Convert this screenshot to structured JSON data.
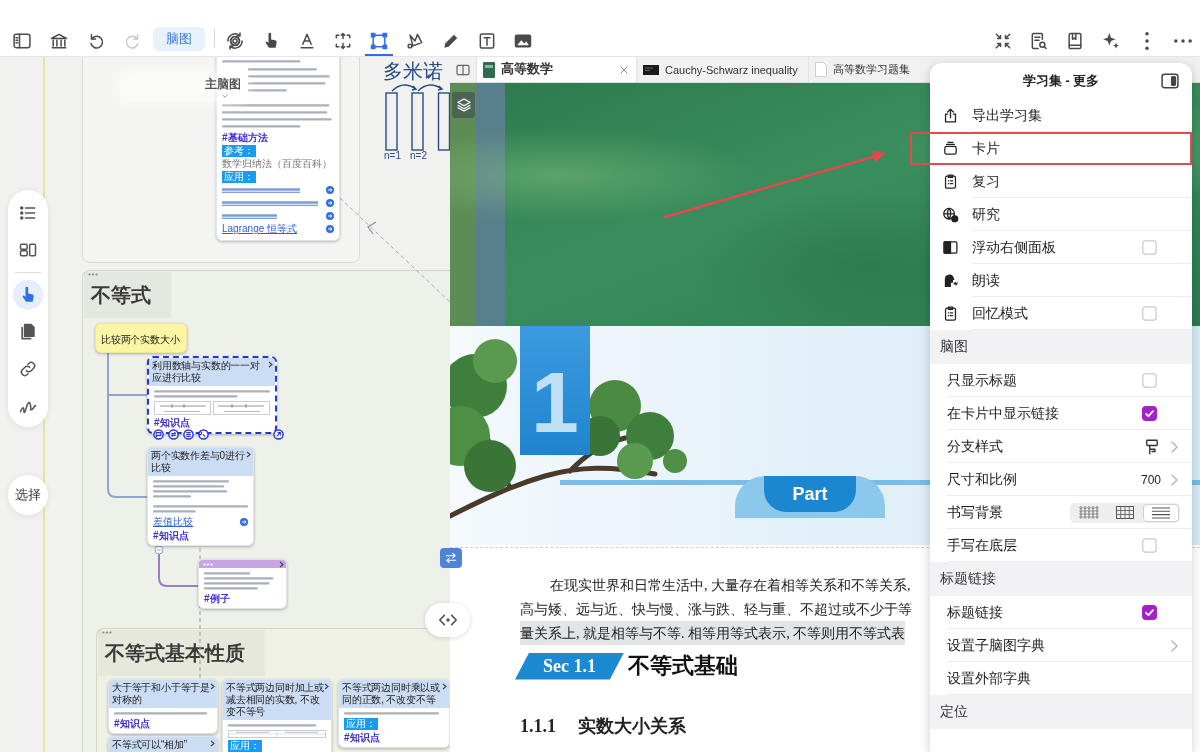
{
  "toolbar": {
    "history": [
      {
        "disabled": false
      },
      {
        "disabled": true
      }
    ],
    "mode_button": "脑图",
    "tools": [
      {
        "selected": false
      },
      {
        "selected": false
      },
      {
        "selected": false
      },
      {
        "selected": false
      },
      {
        "selected": true
      },
      {
        "selected": false
      },
      {
        "selected": false
      },
      {
        "selected": false
      },
      {
        "selected": false
      }
    ]
  },
  "canvas_tools": [
    {
      "selected": false
    },
    {
      "selected": false
    },
    {
      "selected": true
    },
    {
      "selected": false
    },
    {
      "selected": false
    },
    {
      "selected": false
    }
  ],
  "select_button": "选择",
  "mindmap": {
    "title": "主脑图",
    "sketch": {
      "caption": "多米诺",
      "labels": [
        "n=1",
        "n=2"
      ]
    },
    "top_card": {
      "tag": "#基础方法",
      "reference_label": "参考：",
      "reference": "数学归纳法（百度百科）",
      "applications_label": "应用：",
      "link": "Lagrange 恒等式"
    },
    "groups": [
      {
        "title": "不等式",
        "cards": [
          {
            "kind": "topic",
            "title": "比较两个实数大小",
            "selected": false
          },
          {
            "kind": "note",
            "title": "利用数轴与实数的一一对应进行比较",
            "selected": true,
            "figure": {
              "kind": "number-lines"
            },
            "tag": "#知识点"
          },
          {
            "kind": "note",
            "title": "两个实数作差与0进行比较",
            "selected": false,
            "link": "差值比较",
            "tag": "#知识点"
          },
          {
            "kind": "example",
            "selected": false,
            "tag": "#例子"
          }
        ]
      },
      {
        "title": "不等式基本性质",
        "cards": [
          {
            "kind": "note",
            "title": "大于等于和小于等于是对称的",
            "selected": false,
            "tag": "#知识点"
          },
          {
            "kind": "note",
            "title": "不等式可以“相加”",
            "selected": false
          },
          {
            "kind": "note",
            "title": "不等式两边同时加上或减去相同的实数, 不改变不等号",
            "selected": false,
            "figure": {
              "kind": "table"
            },
            "label": "应用："
          },
          {
            "kind": "note",
            "title_lines": [
              "不等式两边同时乘以或",
              "同的正数, 不改变不等"
            ],
            "selected": false,
            "label": "应用：",
            "tag": "#知识点"
          }
        ]
      }
    ]
  },
  "document": {
    "tabs": [
      {
        "title": "高等数学",
        "selected": true
      },
      {
        "title": "Cauchy-Schwarz inequality",
        "selected": false
      },
      {
        "title": "高等数学习题集",
        "selected": false
      }
    ],
    "chapter_number": "1",
    "part_label": "Part",
    "paragraph": [
      {
        "text": "在现实世界和日常生活中, 大量存在着相等关系和不等关系,",
        "highlighted": false
      },
      {
        "text": "高与矮、远与近、快与慢、涨与跌、轻与重、不超过或不少于等",
        "highlighted": false
      },
      {
        "text": "量关系上, 就是相等与不等. 相等用等式表示, 不等则用不等式表",
        "highlighted": true
      }
    ],
    "section": {
      "badge": "Sec 1.1",
      "title": "不等式基础"
    },
    "subsection": {
      "number": "1.1.1",
      "title": "实数大小关系"
    }
  },
  "menu": {
    "title": "学习集 - 更多",
    "sections": [
      {
        "items": [
          {
            "kind": "action",
            "label": "导出学习集",
            "highlighted": false
          },
          {
            "kind": "action",
            "label": "卡片",
            "highlighted": true
          },
          {
            "kind": "action",
            "label": "复习",
            "highlighted": false
          },
          {
            "kind": "action",
            "label": "研究",
            "highlighted": false
          },
          {
            "kind": "toggle",
            "label": "浮动右侧面板",
            "checked": false,
            "highlighted": false
          },
          {
            "kind": "action",
            "label": "朗读",
            "highlighted": false
          },
          {
            "kind": "toggle",
            "label": "回忆模式",
            "checked": false,
            "highlighted": false
          }
        ]
      },
      {
        "header": "脑图",
        "items": [
          {
            "kind": "check",
            "label": "只显示标题",
            "checked": false,
            "highlighted": false
          },
          {
            "kind": "check",
            "label": "在卡片中显示链接",
            "checked": true,
            "highlighted": false
          },
          {
            "kind": "branch",
            "label": "分支样式",
            "highlighted": false
          },
          {
            "kind": "value",
            "label": "尺寸和比例",
            "value": "700",
            "highlighted": false
          },
          {
            "kind": "segmented",
            "label": "书写背景",
            "options": [
              {
                "selected": false
              },
              {
                "selected": false
              },
              {
                "selected": true
              }
            ],
            "highlighted": false
          },
          {
            "kind": "check",
            "label": "手写在底层",
            "checked": false,
            "highlighted": false
          }
        ]
      },
      {
        "header": "标题链接",
        "items": [
          {
            "kind": "check",
            "label": "标题链接",
            "checked": true,
            "highlighted": false
          },
          {
            "kind": "nav",
            "label": "设置子脑图字典",
            "highlighted": false
          },
          {
            "kind": "plain",
            "label": "设置外部字典",
            "highlighted": false
          }
        ]
      },
      {
        "header": "定位"
      }
    ]
  }
}
